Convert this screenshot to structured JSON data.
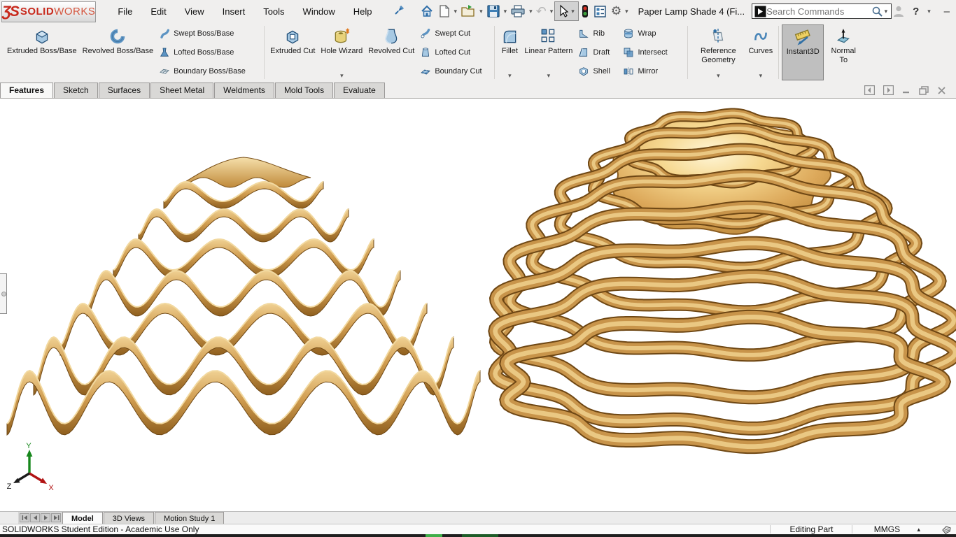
{
  "titlebar": {
    "logo_ds": "ƷS",
    "logo_solid": "SOLID",
    "logo_works": "WORKS",
    "menus": [
      "File",
      "Edit",
      "View",
      "Insert",
      "Tools",
      "Window",
      "Help"
    ],
    "doc_title": "Paper Lamp Shade 4 (Fi...",
    "search_placeholder": "Search Commands",
    "help": "?"
  },
  "glyphs": {
    "dropdown": "▾",
    "units_arrow": "▴",
    "minimize": "–",
    "close": "×",
    "gear": "⚙",
    "undo": "↶"
  },
  "icons": [
    "pushpin-icon",
    "home-icon",
    "new-document-icon",
    "open-icon",
    "save-icon",
    "print-icon",
    "undo-icon",
    "select-cursor-icon",
    "traffic-light-icon",
    "options-list-icon",
    "gear-icon",
    "search-icon",
    "magnifier-icon",
    "user-icon",
    "help-icon",
    "pane-left-icon",
    "pane-right-icon",
    "minimize-icon",
    "restore-icon",
    "close-icon",
    "tag-icon"
  ],
  "ribbon": {
    "extruded_boss": "Extruded Boss/Base",
    "revolved_boss": "Revolved Boss/Base",
    "swept_boss": "Swept Boss/Base",
    "lofted_boss": "Lofted Boss/Base",
    "boundary_boss": "Boundary Boss/Base",
    "extruded_cut": "Extruded Cut",
    "hole_wizard": "Hole Wizard",
    "revolved_cut": "Revolved Cut",
    "swept_cut": "Swept Cut",
    "lofted_cut": "Lofted Cut",
    "boundary_cut": "Boundary Cut",
    "fillet": "Fillet",
    "linear_pattern": "Linear Pattern",
    "rib": "Rib",
    "draft": "Draft",
    "shell": "Shell",
    "wrap": "Wrap",
    "intersect": "Intersect",
    "mirror": "Mirror",
    "reference_geometry": "Reference Geometry",
    "curves": "Curves",
    "instant3d": "Instant3D",
    "normal_to": "Normal To"
  },
  "command_tabs": {
    "active": "Features",
    "items": [
      "Features",
      "Sketch",
      "Surfaces",
      "Sheet Metal",
      "Weldments",
      "Mold Tools",
      "Evaluate"
    ]
  },
  "bottom_tabs": {
    "model": "Model",
    "views": "3D Views",
    "motion": "Motion Study 1"
  },
  "statusbar": {
    "left": "SOLIDWORKS Student Edition - Academic Use Only",
    "editing": "Editing Part",
    "units": "MMGS"
  },
  "triad": {
    "x": "X",
    "y": "Y",
    "z": "Z"
  },
  "colors": {
    "wood_light": "#f0d193",
    "wood_mid": "#c8944a",
    "wood_dark": "#6e4714",
    "logo_red": "#c8291c",
    "icon_blue": "#3a76ad",
    "pressed_bg": "#bfbfbf",
    "viewport_bg": "#ffffff"
  }
}
